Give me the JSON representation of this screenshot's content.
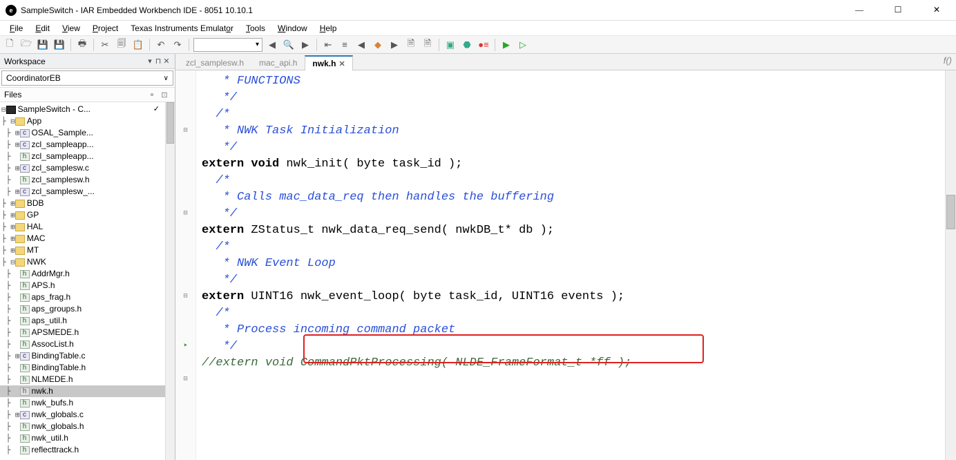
{
  "titlebar": {
    "title": "SampleSwitch - IAR Embedded Workbench IDE - 8051 10.10.1",
    "icon_glyph": "e"
  },
  "menu": [
    {
      "label": "File",
      "u": 0
    },
    {
      "label": "Edit",
      "u": 0
    },
    {
      "label": "View",
      "u": 0
    },
    {
      "label": "Project",
      "u": 0
    },
    {
      "label": "Texas Instruments Emulator",
      "u": 24
    },
    {
      "label": "Tools",
      "u": 0
    },
    {
      "label": "Window",
      "u": 0
    },
    {
      "label": "Help",
      "u": 0
    }
  ],
  "workspace": {
    "title": "Workspace",
    "config": "CoordinatorEB",
    "files_label": "Files"
  },
  "tree": [
    {
      "d": 0,
      "exp": "⊟",
      "icon": "hex",
      "label": "SampleSwitch - C...",
      "chk": "✓"
    },
    {
      "d": 1,
      "exp": "⊟",
      "icon": "folder",
      "label": "App"
    },
    {
      "d": 2,
      "exp": "⊞",
      "icon": "c",
      "label": "OSAL_Sample..."
    },
    {
      "d": 2,
      "exp": "⊞",
      "icon": "c",
      "label": "zcl_sampleapp..."
    },
    {
      "d": 2,
      "exp": " ",
      "icon": "h",
      "label": "zcl_sampleapp..."
    },
    {
      "d": 2,
      "exp": "⊞",
      "icon": "c",
      "label": "zcl_samplesw.c"
    },
    {
      "d": 2,
      "exp": " ",
      "icon": "h",
      "label": "zcl_samplesw.h"
    },
    {
      "d": 2,
      "exp": "⊞",
      "icon": "c",
      "label": "zcl_samplesw_..."
    },
    {
      "d": 1,
      "exp": "⊞",
      "icon": "folder",
      "label": "BDB"
    },
    {
      "d": 1,
      "exp": "⊞",
      "icon": "folder",
      "label": "GP"
    },
    {
      "d": 1,
      "exp": "⊞",
      "icon": "folder",
      "label": "HAL"
    },
    {
      "d": 1,
      "exp": "⊞",
      "icon": "folder",
      "label": "MAC"
    },
    {
      "d": 1,
      "exp": "⊞",
      "icon": "folder",
      "label": "MT"
    },
    {
      "d": 1,
      "exp": "⊟",
      "icon": "folder",
      "label": "NWK"
    },
    {
      "d": 2,
      "exp": " ",
      "icon": "h",
      "label": "AddrMgr.h"
    },
    {
      "d": 2,
      "exp": " ",
      "icon": "h",
      "label": "APS.h"
    },
    {
      "d": 2,
      "exp": " ",
      "icon": "h",
      "label": "aps_frag.h"
    },
    {
      "d": 2,
      "exp": " ",
      "icon": "h",
      "label": "aps_groups.h"
    },
    {
      "d": 2,
      "exp": " ",
      "icon": "h",
      "label": "aps_util.h"
    },
    {
      "d": 2,
      "exp": " ",
      "icon": "h",
      "label": "APSMEDE.h"
    },
    {
      "d": 2,
      "exp": " ",
      "icon": "h",
      "label": "AssocList.h"
    },
    {
      "d": 2,
      "exp": "⊞",
      "icon": "c",
      "label": "BindingTable.c"
    },
    {
      "d": 2,
      "exp": " ",
      "icon": "h",
      "label": "BindingTable.h"
    },
    {
      "d": 2,
      "exp": " ",
      "icon": "h",
      "label": "NLMEDE.h"
    },
    {
      "d": 2,
      "exp": " ",
      "icon": "hgray",
      "label": "nwk.h",
      "sel": true
    },
    {
      "d": 2,
      "exp": " ",
      "icon": "h",
      "label": "nwk_bufs.h"
    },
    {
      "d": 2,
      "exp": "⊞",
      "icon": "c",
      "label": "nwk_globals.c"
    },
    {
      "d": 2,
      "exp": " ",
      "icon": "h",
      "label": "nwk_globals.h"
    },
    {
      "d": 2,
      "exp": " ",
      "icon": "h",
      "label": "nwk_util.h"
    },
    {
      "d": 2,
      "exp": " ",
      "icon": "h",
      "label": "reflecttrack.h"
    }
  ],
  "tabs": [
    {
      "label": "zcl_samplesw.h",
      "active": false
    },
    {
      "label": "mac_api.h",
      "active": false
    },
    {
      "label": "nwk.h",
      "active": true
    }
  ],
  "code": {
    "lines": [
      {
        "g": "",
        "spans": [
          {
            "c": "cm",
            "t": "   * FUNCTIONS"
          }
        ]
      },
      {
        "g": "",
        "spans": [
          {
            "c": "cm",
            "t": "   */"
          }
        ]
      },
      {
        "g": "",
        "spans": [
          {
            "c": "",
            "t": ""
          }
        ]
      },
      {
        "g": "box",
        "spans": [
          {
            "c": "cm",
            "t": "  /*"
          }
        ]
      },
      {
        "g": "",
        "spans": [
          {
            "c": "cm",
            "t": "   * NWK Task Initialization"
          }
        ]
      },
      {
        "g": "",
        "spans": [
          {
            "c": "cm",
            "t": "   */"
          }
        ]
      },
      {
        "g": "",
        "spans": [
          {
            "c": "kw",
            "t": "extern void"
          },
          {
            "c": "",
            "t": " nwk_init( byte task_id );"
          }
        ]
      },
      {
        "g": "",
        "spans": [
          {
            "c": "",
            "t": ""
          }
        ]
      },
      {
        "g": "box",
        "spans": [
          {
            "c": "cm",
            "t": "  /*"
          }
        ]
      },
      {
        "g": "",
        "spans": [
          {
            "c": "cm",
            "t": "   * Calls mac_data_req then handles the buffering"
          }
        ]
      },
      {
        "g": "",
        "spans": [
          {
            "c": "cm",
            "t": "   */"
          }
        ]
      },
      {
        "g": "",
        "spans": [
          {
            "c": "kw",
            "t": "extern"
          },
          {
            "c": "",
            "t": " ZStatus_t nwk_data_req_send( nwkDB_t* db );"
          }
        ]
      },
      {
        "g": "",
        "spans": [
          {
            "c": "",
            "t": ""
          }
        ]
      },
      {
        "g": "box",
        "spans": [
          {
            "c": "cm",
            "t": "  /*"
          }
        ]
      },
      {
        "g": "",
        "spans": [
          {
            "c": "cm",
            "t": "   * NWK Event Loop"
          }
        ]
      },
      {
        "g": "",
        "spans": [
          {
            "c": "cm",
            "t": "   */"
          }
        ]
      },
      {
        "g": "arrow",
        "spans": [
          {
            "c": "kw",
            "t": "extern"
          },
          {
            "c": "",
            "t": " UINT16 nwk_event_loop( byte task_id, UINT16 events );"
          }
        ]
      },
      {
        "g": "",
        "spans": [
          {
            "c": "",
            "t": ""
          }
        ]
      },
      {
        "g": "box",
        "spans": [
          {
            "c": "cm",
            "t": "  /*"
          }
        ]
      },
      {
        "g": "",
        "spans": [
          {
            "c": "cm",
            "t": "   * Process incoming command packet"
          }
        ]
      },
      {
        "g": "",
        "spans": [
          {
            "c": "cm",
            "t": "   */"
          }
        ]
      },
      {
        "g": "",
        "spans": [
          {
            "c": "cm2",
            "t": "//extern void CommandPktProcessing( NLDE_FrameFormat_t *ff );"
          }
        ]
      }
    ],
    "highlight": {
      "text": "nwk_event_loop( byte task_id, UINT16 events );"
    }
  }
}
